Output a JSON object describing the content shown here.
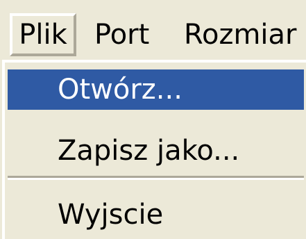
{
  "menubar": {
    "items": [
      {
        "label": "Plik",
        "state": "open"
      },
      {
        "label": "Port"
      },
      {
        "label": "Rozmiar"
      }
    ]
  },
  "dropdown": {
    "items": [
      {
        "label": "Otwórz...",
        "highlighted": true
      },
      {
        "label": "Zapisz jako..."
      },
      {
        "type": "separator"
      },
      {
        "label": "Wyjscie"
      }
    ]
  },
  "colors": {
    "menu_background": "#ece9d8",
    "highlight": "#2f5aa4",
    "highlight_text": "#ffffff",
    "text": "#000000"
  }
}
